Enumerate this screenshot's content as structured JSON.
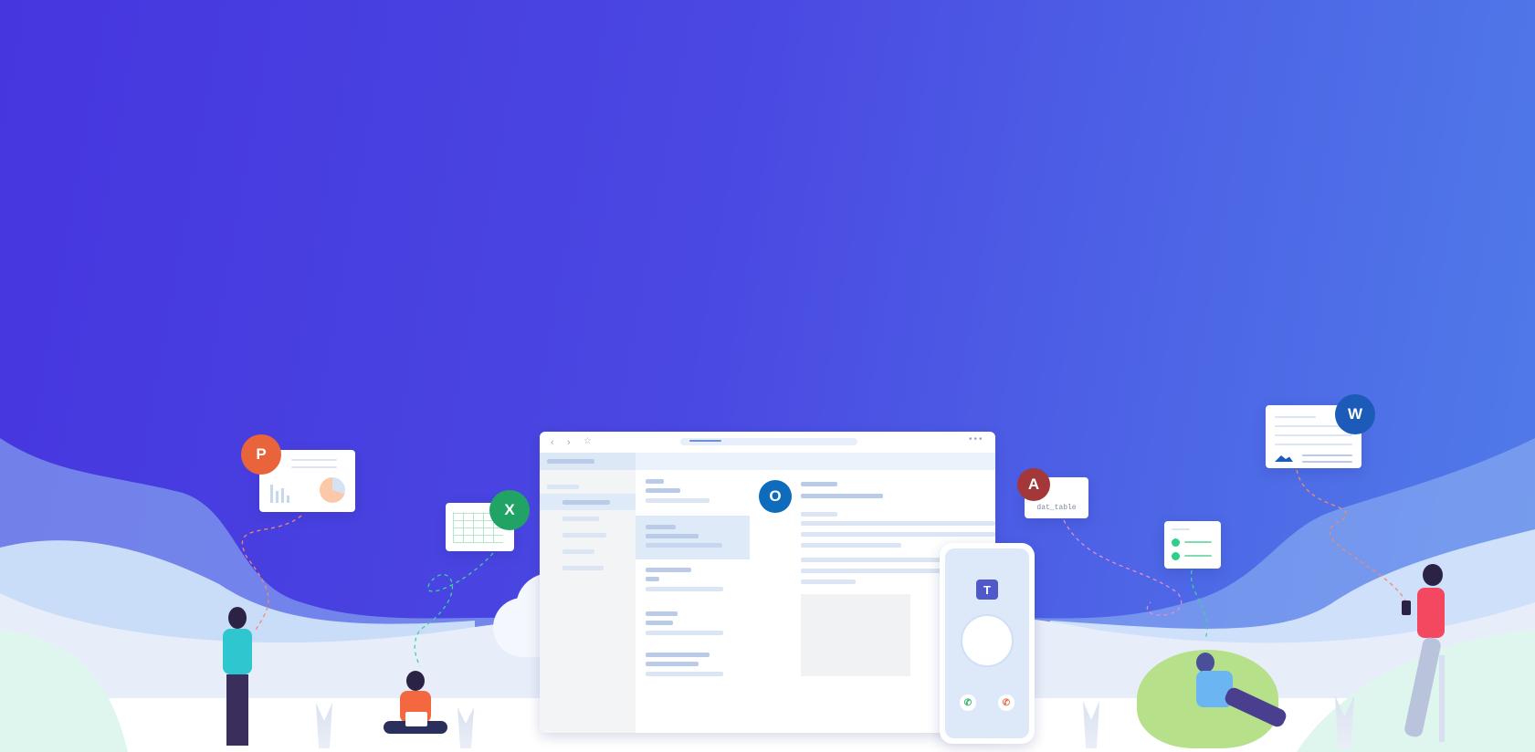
{
  "access_card": {
    "label": "dat_table"
  },
  "colors": {
    "bg_start": "#4636de",
    "bg_end": "#507ce9",
    "powerpoint": "#e9643b",
    "excel": "#21a366",
    "outlook": "#0f6cbd",
    "access": "#a4373a",
    "word": "#1d5bb8",
    "teams": "#5059c9"
  }
}
